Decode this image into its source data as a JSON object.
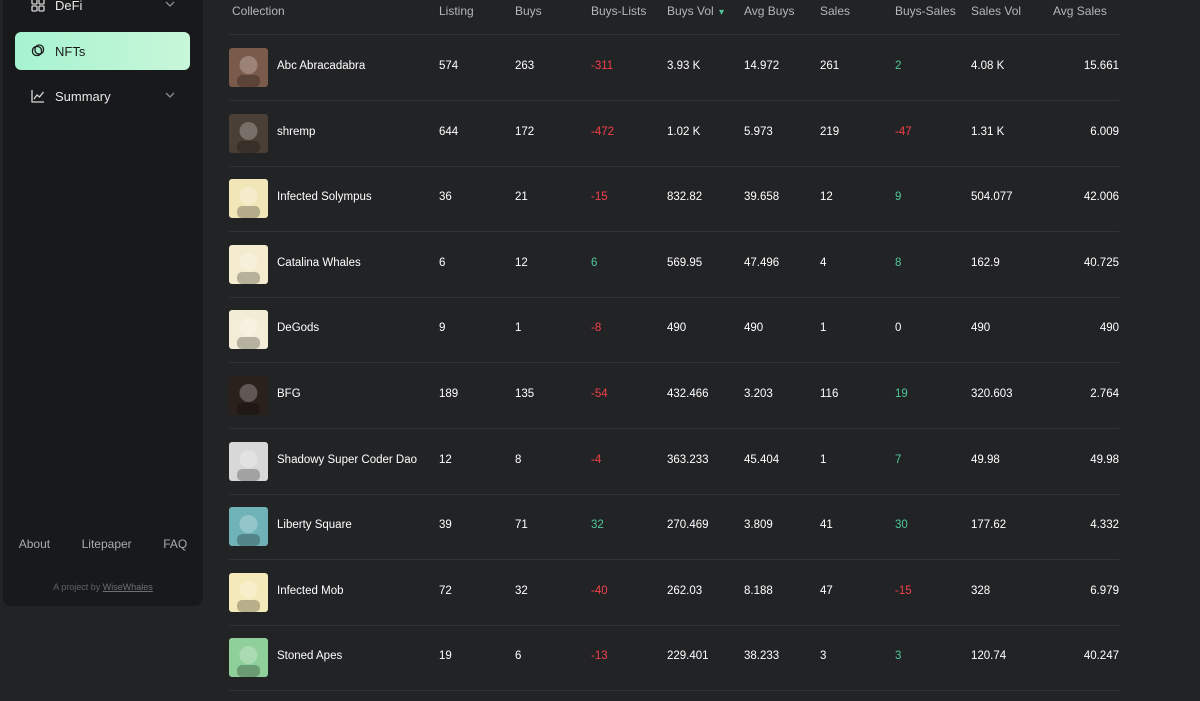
{
  "sidebar": {
    "items": [
      {
        "label": "DeFi",
        "icon": "grid-icon"
      },
      {
        "label": "NFTs",
        "icon": "nft-icon"
      },
      {
        "label": "Summary",
        "icon": "chart-line-icon"
      }
    ],
    "footer": {
      "about": "About",
      "litepaper": "Litepaper",
      "faq": "FAQ"
    },
    "credit_prefix": "A project by",
    "credit_link": "WiseWhales"
  },
  "table": {
    "headers": [
      "Collection",
      "Listing",
      "Buys",
      "Buys-Lists",
      "Buys Vol",
      "Avg Buys",
      "Sales",
      "Buys-Sales",
      "Sales Vol",
      "Avg Sales"
    ],
    "sort_indicator": "▾",
    "rows": [
      {
        "collection": "Abc Abracadabra",
        "listing": "574",
        "buys": "263",
        "buys_lists": "-311",
        "buys_vol": "3.93 K",
        "avg_buys": "14.972",
        "sales": "261",
        "buys_sales": "2",
        "sales_vol": "4.08 K",
        "avg_sales": "15.661",
        "thumb_bg": "#7a5a4a"
      },
      {
        "collection": "shremp",
        "listing": "644",
        "buys": "172",
        "buys_lists": "-472",
        "buys_vol": "1.02 K",
        "avg_buys": "5.973",
        "sales": "219",
        "buys_sales": "-47",
        "sales_vol": "1.31 K",
        "avg_sales": "6.009",
        "thumb_bg": "#4a3f36"
      },
      {
        "collection": "Infected Solympus",
        "listing": "36",
        "buys": "21",
        "buys_lists": "-15",
        "buys_vol": "832.82",
        "avg_buys": "39.658",
        "sales": "12",
        "buys_sales": "9",
        "sales_vol": "504.077",
        "avg_sales": "42.006",
        "thumb_bg": "#f1e6b8"
      },
      {
        "collection": "Catalina Whales",
        "listing": "6",
        "buys": "12",
        "buys_lists": "6",
        "buys_vol": "569.95",
        "avg_buys": "47.496",
        "sales": "4",
        "buys_sales": "8",
        "sales_vol": "162.9",
        "avg_sales": "40.725",
        "thumb_bg": "#f5eccf"
      },
      {
        "collection": "DeGods",
        "listing": "9",
        "buys": "1",
        "buys_lists": "-8",
        "buys_vol": "490",
        "avg_buys": "490",
        "sales": "1",
        "buys_sales": "0",
        "sales_vol": "490",
        "avg_sales": "490",
        "thumb_bg": "#f3ecd6"
      },
      {
        "collection": "BFG",
        "listing": "189",
        "buys": "135",
        "buys_lists": "-54",
        "buys_vol": "432.466",
        "avg_buys": "3.203",
        "sales": "116",
        "buys_sales": "19",
        "sales_vol": "320.603",
        "avg_sales": "2.764",
        "thumb_bg": "#2b211c"
      },
      {
        "collection": "Shadowy Super Coder Dao",
        "listing": "12",
        "buys": "8",
        "buys_lists": "-4",
        "buys_vol": "363.233",
        "avg_buys": "45.404",
        "sales": "1",
        "buys_sales": "7",
        "sales_vol": "49.98",
        "avg_sales": "49.98",
        "thumb_bg": "#d8d8d8"
      },
      {
        "collection": "Liberty Square",
        "listing": "39",
        "buys": "71",
        "buys_lists": "32",
        "buys_vol": "270.469",
        "avg_buys": "3.809",
        "sales": "41",
        "buys_sales": "30",
        "sales_vol": "177.62",
        "avg_sales": "4.332",
        "thumb_bg": "#6fb3b8"
      },
      {
        "collection": "Infected Mob",
        "listing": "72",
        "buys": "32",
        "buys_lists": "-40",
        "buys_vol": "262.03",
        "avg_buys": "8.188",
        "sales": "47",
        "buys_sales": "-15",
        "sales_vol": "328",
        "avg_sales": "6.979",
        "thumb_bg": "#f4e9b8"
      },
      {
        "collection": "Stoned Apes",
        "listing": "19",
        "buys": "6",
        "buys_lists": "-13",
        "buys_vol": "229.401",
        "avg_buys": "38.233",
        "sales": "3",
        "buys_sales": "3",
        "sales_vol": "120.74",
        "avg_sales": "40.247",
        "thumb_bg": "#8fcf9a"
      }
    ]
  },
  "colors": {
    "negative": "#f2404a",
    "positive": "#4fc79b",
    "accent": "#a6f3d0"
  }
}
